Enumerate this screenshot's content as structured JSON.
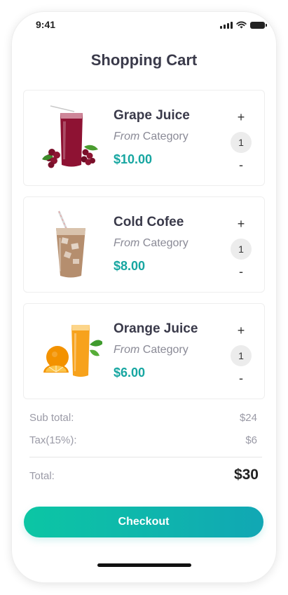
{
  "status": {
    "time": "9:41"
  },
  "header": {
    "title": "Shopping Cart"
  },
  "cart": {
    "items": [
      {
        "name": "Grape Juice",
        "category_prefix": "From",
        "category": "Category",
        "price": "$10.00",
        "quantity": "1",
        "image_icon": "grape-juice-image"
      },
      {
        "name": "Cold Cofee",
        "category_prefix": "From",
        "category": "Category",
        "price": "$8.00",
        "quantity": "1",
        "image_icon": "iced-coffee-image"
      },
      {
        "name": "Orange Juice",
        "category_prefix": "From",
        "category": "Category",
        "price": "$6.00",
        "quantity": "1",
        "image_icon": "orange-juice-image"
      }
    ],
    "plus_label": "+",
    "minus_label": "-"
  },
  "summary": {
    "subtotal_label": "Sub total:",
    "subtotal_value": "$24",
    "tax_label": "Tax(15%):",
    "tax_value": "$6",
    "total_label": "Total:",
    "total_value": "$30"
  },
  "checkout": {
    "label": "Checkout"
  },
  "colors": {
    "accent": "#17a6a1",
    "button_start": "#0cc6a4",
    "button_end": "#11a7b4"
  }
}
